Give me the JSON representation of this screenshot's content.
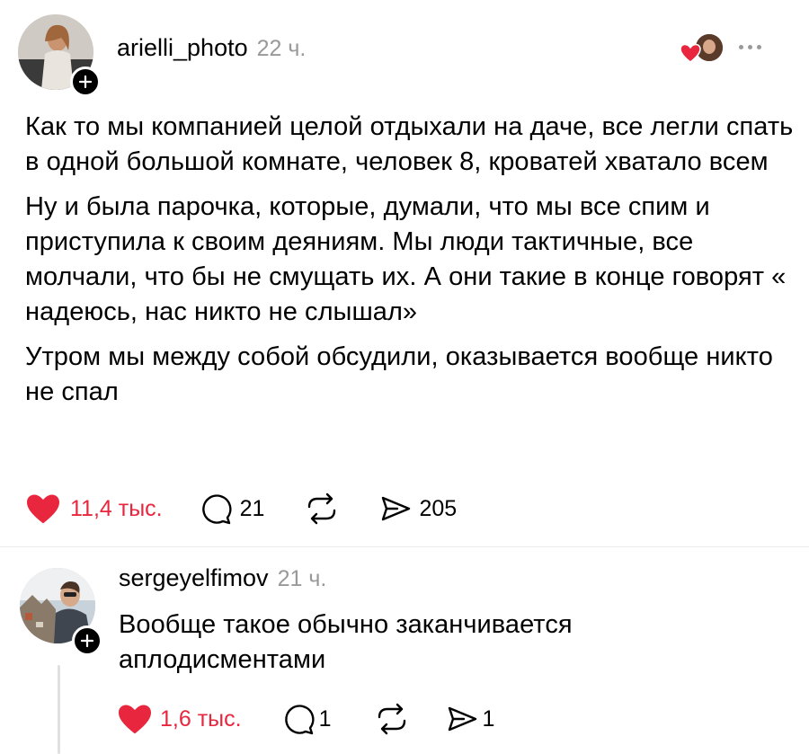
{
  "post": {
    "username": "arielli_photo",
    "time": "22 ч.",
    "paragraphs": [
      "Как то мы компанией целой отдыхали на даче, все легли спать в одной большой комнате, человек 8, кроватей хватало всем",
      "Ну и была парочка, которые, думали, что мы все спим и приступила к своим деяниям. Мы люди тактичные, все молчали, что бы не смущать их. А они такие в конце говорят « надеюсь, нас никто не слышал»",
      "Утром мы между собой обсудили, оказывается вообще никто не спал"
    ],
    "likes": "11,4 тыс.",
    "liked": true,
    "comments": "21",
    "shares": "205"
  },
  "reply": {
    "username": "sergeyelfimov",
    "time": "21 ч.",
    "text": "Вообще такое обычно заканчивается аплодисментами",
    "likes": "1,6 тыс.",
    "liked": true,
    "comments": "1",
    "shares": "1"
  },
  "colors": {
    "like_red": "#e8263e",
    "muted_gray": "#999999",
    "thread_line": "#e0e0e0"
  },
  "icons": [
    "plus-icon",
    "heart-icon",
    "comment-icon",
    "repost-icon",
    "share-icon",
    "more-icon"
  ]
}
